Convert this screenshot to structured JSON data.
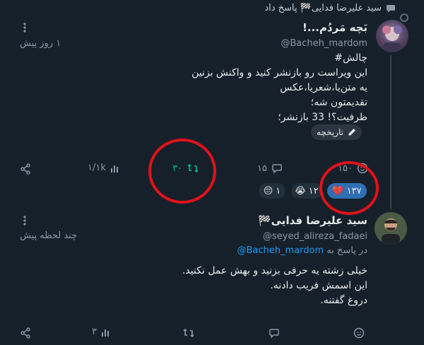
{
  "replied_header": {
    "text": "سید علیرضا فدایی🏁 پاسخ داد"
  },
  "post1": {
    "display_name": "بَچه مَردُم...!",
    "handle": "@Bacheh_mardom",
    "time": "۱ روز پیش",
    "lines": [
      "چالش#",
      "این ویراست رو بازنشر کنید و واکنش بزنین",
      "یه متن‌یا،شعریا،عکس",
      "تقدیمتون شه؛",
      "ظرفیت؟! 33 بازنشر؛"
    ],
    "history_label": "تاریخچه",
    "metrics": {
      "replies": "۱۵",
      "reposts": "۳۰",
      "likes": "۱۵۰",
      "views": "۱/۱k"
    },
    "reactions": [
      {
        "emoji": "💔",
        "count": "۱۳۷",
        "active": true
      },
      {
        "emoji": "😭",
        "count": "۱۲",
        "active": false
      },
      {
        "emoji": "😔",
        "count": "۱",
        "active": false
      }
    ]
  },
  "post2": {
    "display_name": "سید علیرضا فدایی🏁",
    "handle": "@seyed_alireza_fadaei",
    "time": "چند لحظه پیش",
    "reply_prefix": "در پاسخ به",
    "reply_to": "@Bacheh_mardom",
    "lines": [
      "خیلی زشته یه حرفی بزنید و بهش عمل نکنید.",
      "این اسمش فریب دادنه.",
      "دروغ گفتنه."
    ],
    "metrics": {
      "views": "۳"
    }
  },
  "colors": {
    "background": "#15202b",
    "accent_blue": "#1d9bf0",
    "repost_green": "#00ba7c",
    "annotation_red": "#e0121a",
    "muted": "#8b98a5"
  }
}
